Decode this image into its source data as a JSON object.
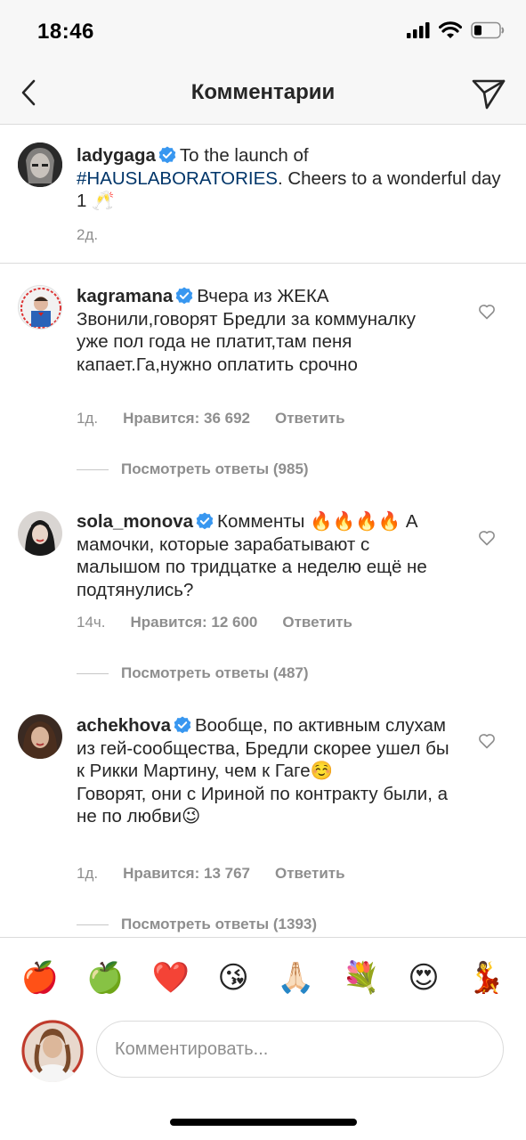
{
  "status_bar": {
    "time": "18:46",
    "signal_icon": "signal-icon",
    "wifi_icon": "wifi-icon",
    "battery_icon": "battery-icon"
  },
  "header": {
    "title": "Комментарии",
    "back_icon": "chevron-left-icon",
    "send_icon": "paper-plane-icon"
  },
  "caption": {
    "username": "ladygaga",
    "text_before": "To the launch of ",
    "hashtag": "#HAUSLABORATORIES",
    "text_after": ". Cheers to a wonderful day 1 🥂",
    "time": "2д."
  },
  "comments": [
    {
      "username": "kagramana",
      "text": "Вчера из ЖЕКА Звонили,говорят Бредли за коммуналку уже пол года не платит,там пеня капает.Га,нужно оплатить срочно",
      "time": "1д.",
      "likes": "Нравится: 36 692",
      "reply": "Ответить",
      "view_replies": "Посмотреть ответы (985)"
    },
    {
      "username": "sola_monova",
      "text": "Комменты 🔥🔥🔥🔥 А мамочки, которые зарабатывают с малышом по тридцатке а неделю ещё не подтянулись?",
      "time": "14ч.",
      "likes": "Нравится: 12 600",
      "reply": "Ответить",
      "view_replies": "Посмотреть ответы (487)"
    },
    {
      "username": "achekhova",
      "text": "Вообще, по активным слухам из гей-сообщества, Бредли скорее ушел бы к Рикки Мартину, чем к Гаге☺️",
      "text2": "Говорят, они с Ириной по контракту были, а не по любви😉",
      "time": "1д.",
      "likes": "Нравится: 13 767",
      "reply": "Ответить",
      "view_replies": "Посмотреть ответы (1393)"
    }
  ],
  "emoji_bar": [
    "🍎",
    "🍏",
    "❤️",
    "😘",
    "🙏🏻",
    "💐",
    "😍",
    "💃"
  ],
  "input": {
    "placeholder": "Комментировать..."
  },
  "colors": {
    "link": "#003569",
    "verified": "#3897f0",
    "muted": "#8e8e8e",
    "text": "#262626"
  }
}
